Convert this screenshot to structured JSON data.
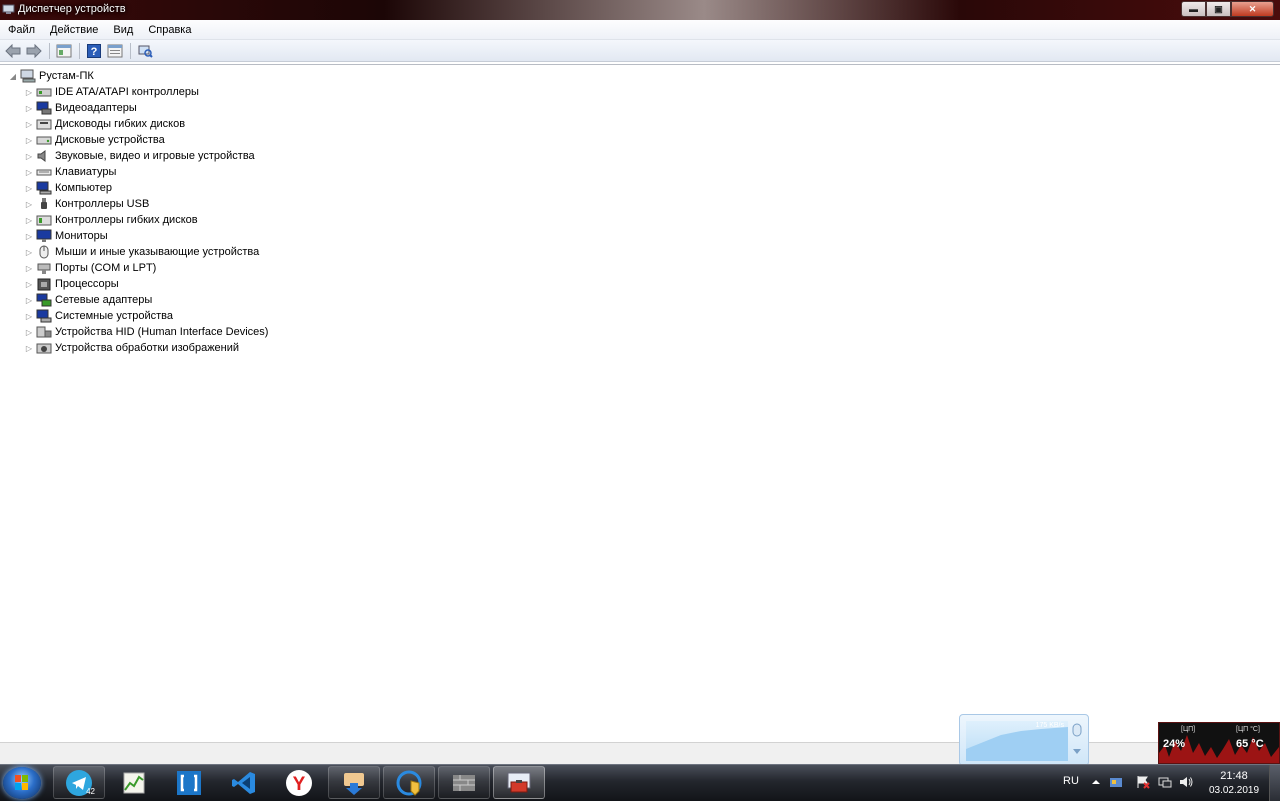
{
  "window": {
    "title": "Диспетчер устройств",
    "buttons": {
      "minimize": "▬",
      "maximize": "▣",
      "close": "✕"
    }
  },
  "menu": [
    "Файл",
    "Действие",
    "Вид",
    "Справка"
  ],
  "toolbar": [
    "back-arrow-icon",
    "forward-arrow-icon",
    "properties-icon",
    "help-icon",
    "view-icon",
    "scan-hardware-icon"
  ],
  "tree": {
    "root": "Рустам-ПК",
    "items": [
      {
        "label": "IDE ATA/ATAPI контроллеры",
        "icon": "ide-controller-icon"
      },
      {
        "label": "Видеоадаптеры",
        "icon": "display-adapter-icon"
      },
      {
        "label": "Дисководы гибких дисков",
        "icon": "floppy-drive-icon"
      },
      {
        "label": "Дисковые устройства",
        "icon": "disk-drive-icon"
      },
      {
        "label": "Звуковые, видео и игровые устройства",
        "icon": "speaker-icon"
      },
      {
        "label": "Клавиатуры",
        "icon": "keyboard-icon"
      },
      {
        "label": "Компьютер",
        "icon": "computer-icon"
      },
      {
        "label": "Контроллеры USB",
        "icon": "usb-icon"
      },
      {
        "label": "Контроллеры гибких дисков",
        "icon": "floppy-controller-icon"
      },
      {
        "label": "Мониторы",
        "icon": "monitor-icon"
      },
      {
        "label": "Мыши и иные указывающие устройства",
        "icon": "mouse-icon"
      },
      {
        "label": "Порты (COM и LPT)",
        "icon": "port-icon"
      },
      {
        "label": "Процессоры",
        "icon": "processor-icon"
      },
      {
        "label": "Сетевые адаптеры",
        "icon": "network-adapter-icon"
      },
      {
        "label": "Системные устройства",
        "icon": "system-device-icon"
      },
      {
        "label": "Устройства HID (Human Interface Devices)",
        "icon": "hid-icon"
      },
      {
        "label": "Устройства обработки изображений",
        "icon": "imaging-device-icon"
      }
    ]
  },
  "gadgets": {
    "network": {
      "speed": "175 KB/s"
    },
    "cpu": {
      "label_load": "[ЦП]",
      "load": "24%",
      "label_temp": "[ЦП °C]",
      "temp": "65 °C"
    }
  },
  "taskbar": {
    "apps": [
      {
        "name": "telegram",
        "badge": "42"
      },
      {
        "name": "stocks-app"
      },
      {
        "name": "brackets-editor"
      },
      {
        "name": "visual-studio-code"
      },
      {
        "name": "yandex-browser"
      },
      {
        "name": "downloader"
      },
      {
        "name": "security-shield"
      },
      {
        "name": "firewall"
      },
      {
        "name": "device-manager"
      }
    ],
    "language": "RU",
    "time": "21:48",
    "date": "03.02.2019"
  },
  "colors": {
    "accent": "#2b6ec8",
    "titlebar": "#3a0a0a",
    "close": "#c03a20"
  }
}
